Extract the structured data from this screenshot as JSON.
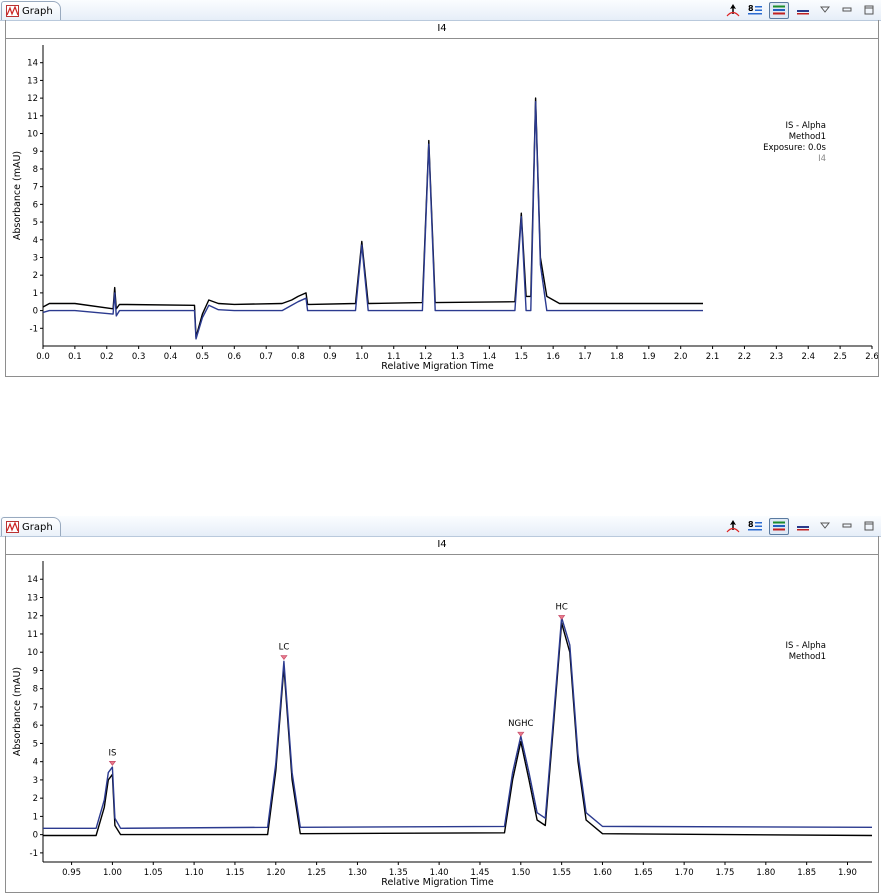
{
  "panels": [
    {
      "tab_label": "Graph",
      "title": "I4",
      "legend": [
        "IS - Alpha",
        "Method1",
        "Exposure: 0.0s",
        "I4"
      ],
      "xlabel": "Relative Migration Time",
      "ylabel": "Absorbance (mAU)",
      "xticks": [
        "0.0",
        "0.1",
        "0.2",
        "0.3",
        "0.4",
        "0.5",
        "0.6",
        "0.7",
        "0.8",
        "0.9",
        "1.0",
        "1.1",
        "1.2",
        "1.3",
        "1.4",
        "1.5",
        "1.6",
        "1.7",
        "1.8",
        "1.9",
        "2.0",
        "2.1",
        "2.2",
        "2.3",
        "2.4",
        "2.5",
        "2.6"
      ],
      "yticks": [
        "-1",
        "0",
        "1",
        "2",
        "3",
        "4",
        "5",
        "6",
        "7",
        "8",
        "9",
        "10",
        "11",
        "12",
        "13",
        "14"
      ]
    },
    {
      "tab_label": "Graph",
      "title": "I4",
      "legend": [
        "IS - Alpha",
        "Method1"
      ],
      "xlabel": "Relative Migration Time",
      "ylabel": "Absorbance (mAU)",
      "xticks": [
        "0.95",
        "1.00",
        "1.05",
        "1.10",
        "1.15",
        "1.20",
        "1.25",
        "1.30",
        "1.35",
        "1.40",
        "1.45",
        "1.50",
        "1.55",
        "1.60",
        "1.65",
        "1.70",
        "1.75",
        "1.80",
        "1.85",
        "1.90"
      ],
      "yticks": [
        "-1",
        "0",
        "1",
        "2",
        "3",
        "4",
        "5",
        "6",
        "7",
        "8",
        "9",
        "10",
        "11",
        "12",
        "13",
        "14"
      ],
      "peak_labels": [
        "IS",
        "LC",
        "NGHC",
        "HC"
      ]
    }
  ],
  "chart_data": [
    {
      "type": "line",
      "title": "I4",
      "xlabel": "Relative Migration Time",
      "ylabel": "Absorbance (mAU)",
      "xlim": [
        0.0,
        2.6
      ],
      "ylim": [
        -2,
        15
      ],
      "grid": false,
      "legend_position": "top-right",
      "series": [
        {
          "color": "#000000",
          "x": [
            0.0,
            0.02,
            0.1,
            0.22,
            0.225,
            0.23,
            0.24,
            0.47,
            0.475,
            0.48,
            0.5,
            0.52,
            0.55,
            0.6,
            0.75,
            0.78,
            0.8,
            0.825,
            0.83,
            0.84,
            0.98,
            1.0,
            1.02,
            1.19,
            1.21,
            1.23,
            1.48,
            1.5,
            1.515,
            1.53,
            1.545,
            1.56,
            1.58,
            1.62,
            2.07
          ],
          "y": [
            0.2,
            0.4,
            0.4,
            0.1,
            1.3,
            0.1,
            0.35,
            0.3,
            0.3,
            -1.5,
            -0.2,
            0.6,
            0.4,
            0.35,
            0.4,
            0.6,
            0.8,
            1.0,
            0.35,
            0.35,
            0.4,
            3.9,
            0.4,
            0.45,
            9.6,
            0.45,
            0.5,
            5.5,
            0.8,
            0.8,
            12.0,
            3.0,
            0.8,
            0.4,
            0.4
          ]
        },
        {
          "color": "#2b3a8f",
          "x": [
            0.0,
            0.02,
            0.1,
            0.22,
            0.225,
            0.23,
            0.24,
            0.47,
            0.475,
            0.48,
            0.5,
            0.52,
            0.55,
            0.6,
            0.75,
            0.78,
            0.8,
            0.825,
            0.83,
            0.84,
            0.98,
            1.0,
            1.02,
            1.19,
            1.21,
            1.23,
            1.48,
            1.5,
            1.515,
            1.53,
            1.545,
            1.56,
            1.58,
            1.62,
            2.07
          ],
          "y": [
            -0.1,
            0.0,
            0.0,
            -0.2,
            1.0,
            -0.3,
            0.0,
            0.0,
            0.0,
            -1.6,
            -0.4,
            0.3,
            0.05,
            0.0,
            0.0,
            0.3,
            0.5,
            0.7,
            0.0,
            0.0,
            0.0,
            3.7,
            0.0,
            0.0,
            9.4,
            0.0,
            0.0,
            5.3,
            0.0,
            0.0,
            11.8,
            2.6,
            0.0,
            0.0,
            0.0
          ]
        }
      ]
    },
    {
      "type": "line",
      "title": "I4",
      "xlabel": "Relative Migration Time",
      "ylabel": "Absorbance (mAU)",
      "xlim": [
        0.915,
        1.93
      ],
      "ylim": [
        -1.5,
        15
      ],
      "grid": false,
      "legend_position": "top-right",
      "peaks": [
        {
          "label": "IS",
          "x": 1.0,
          "y": 3.8
        },
        {
          "label": "LC",
          "x": 1.21,
          "y": 9.6
        },
        {
          "label": "NGHC",
          "x": 1.5,
          "y": 5.4
        },
        {
          "label": "HC",
          "x": 1.55,
          "y": 11.8
        }
      ],
      "series": [
        {
          "color": "#000000",
          "x": [
            0.915,
            0.98,
            0.99,
            0.995,
            1.0,
            1.003,
            1.01,
            1.19,
            1.2,
            1.21,
            1.22,
            1.23,
            1.48,
            1.49,
            1.5,
            1.51,
            1.52,
            1.53,
            1.54,
            1.55,
            1.56,
            1.57,
            1.58,
            1.6,
            1.93
          ],
          "y": [
            -0.05,
            -0.05,
            1.5,
            3.0,
            3.3,
            0.5,
            0.0,
            0.0,
            3.5,
            9.2,
            3.0,
            0.05,
            0.1,
            3.0,
            5.1,
            3.0,
            0.8,
            0.5,
            6.0,
            11.6,
            10.0,
            4.0,
            0.8,
            0.05,
            -0.05
          ]
        },
        {
          "color": "#2b3a8f",
          "x": [
            0.915,
            0.98,
            0.99,
            0.995,
            1.0,
            1.003,
            1.01,
            1.19,
            1.2,
            1.21,
            1.22,
            1.23,
            1.48,
            1.49,
            1.5,
            1.51,
            1.52,
            1.53,
            1.54,
            1.55,
            1.56,
            1.57,
            1.58,
            1.6,
            1.93
          ],
          "y": [
            0.35,
            0.35,
            1.9,
            3.4,
            3.7,
            0.9,
            0.35,
            0.4,
            3.9,
            9.5,
            3.4,
            0.4,
            0.45,
            3.4,
            5.4,
            3.4,
            1.2,
            0.9,
            6.4,
            11.9,
            10.4,
            4.4,
            1.2,
            0.45,
            0.4
          ]
        }
      ]
    }
  ]
}
